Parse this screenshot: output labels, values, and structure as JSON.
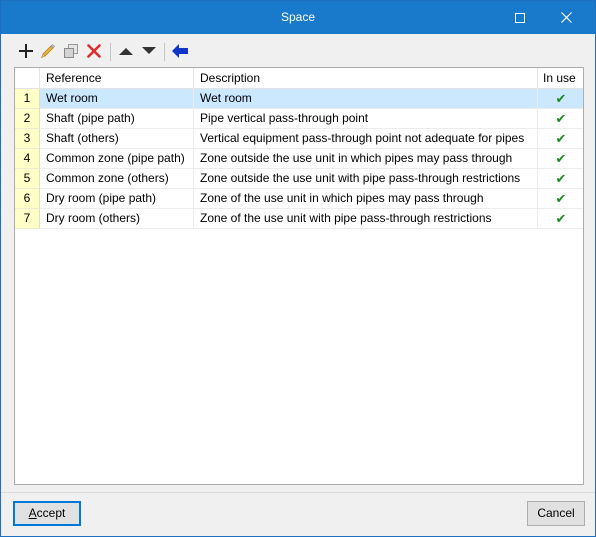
{
  "window": {
    "title": "Space"
  },
  "titlebar_icons": {
    "maximize": "maximize-icon",
    "close": "close-icon"
  },
  "toolbar": {
    "buttons": [
      {
        "name": "add",
        "icon": "plus-icon"
      },
      {
        "name": "edit",
        "icon": "pencil-icon"
      },
      {
        "name": "copy",
        "icon": "copy-icon"
      },
      {
        "name": "delete",
        "icon": "delete-x-icon"
      },
      {
        "name": "move-up",
        "icon": "triangle-up-icon"
      },
      {
        "name": "move-down",
        "icon": "triangle-down-icon"
      },
      {
        "name": "import",
        "icon": "arrow-left-icon"
      }
    ],
    "colors": {
      "delete": "#d9302b",
      "import": "#1036c7",
      "edit": "#e8b63a"
    }
  },
  "table": {
    "columns": [
      "Reference",
      "Description",
      "In use"
    ],
    "rows": [
      {
        "num": "1",
        "reference": "Wet room",
        "description": "Wet room",
        "in_use": "✔"
      },
      {
        "num": "2",
        "reference": "Shaft (pipe path)",
        "description": "Pipe vertical pass-through point",
        "in_use": "✔"
      },
      {
        "num": "3",
        "reference": "Shaft (others)",
        "description": "Vertical equipment pass-through point not adequate for pipes",
        "in_use": "✔"
      },
      {
        "num": "4",
        "reference": "Common zone (pipe path)",
        "description": "Zone outside the use unit in which pipes may pass through",
        "in_use": "✔"
      },
      {
        "num": "5",
        "reference": "Common zone (others)",
        "description": "Zone outside the use unit with pipe pass-through restrictions",
        "in_use": "✔"
      },
      {
        "num": "6",
        "reference": "Dry room (pipe path)",
        "description": "Zone of the use unit in which pipes may pass through",
        "in_use": "✔"
      },
      {
        "num": "7",
        "reference": "Dry room (others)",
        "description": "Zone of the use unit with pipe pass-through restrictions",
        "in_use": "✔"
      }
    ],
    "selected_row": "1",
    "colors": {
      "selected": "#cce8ff",
      "row_number_bg": "#ffffc8",
      "check": "#1a8a1a"
    }
  },
  "footer": {
    "accept_label": "Accept",
    "accept_underline": "A",
    "accept_rest": "ccept",
    "cancel_label": "Cancel"
  }
}
